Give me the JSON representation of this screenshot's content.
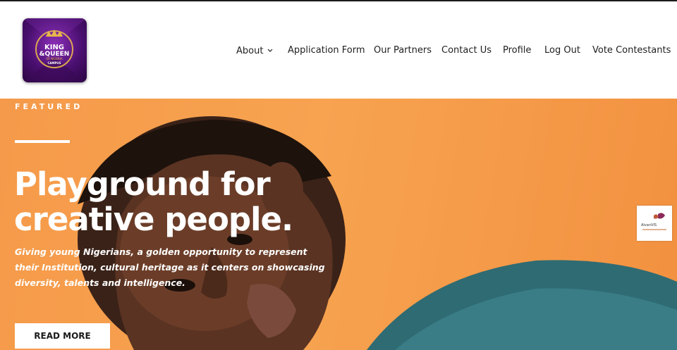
{
  "header": {
    "logo": {
      "lines": [
        "KING",
        "&QUEEN",
        "OF NIGERIA",
        "CAMPUS"
      ]
    },
    "nav": [
      {
        "label": "About",
        "has_dropdown": true,
        "icon": "chevron-down-icon"
      },
      {
        "label": "Application Form"
      },
      {
        "label": "Our Partners"
      },
      {
        "label": "Contact Us"
      },
      {
        "label": "Profile"
      },
      {
        "label": "Log Out"
      },
      {
        "label": "Vote Contestants"
      }
    ]
  },
  "hero": {
    "eyebrow": "FEATURED",
    "headline_line1": "Playground for",
    "headline_line2": "creative people.",
    "subtext": "Giving young Nigerians, a golden opportunity to represent their Institution, cultural heritage as it centers on showcasing diversity, talents and intelligence.",
    "cta_label": "READ MORE",
    "background_color": "#f59a4a"
  },
  "side_badge": {
    "text": "AlvanVIS"
  },
  "colors": {
    "logo_purple": "#5a1480",
    "logo_gold": "#e8b64a",
    "text_dark": "#1f1f1f"
  }
}
